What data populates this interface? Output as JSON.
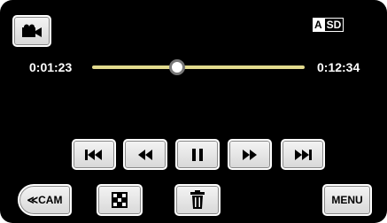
{
  "badge": {
    "a": "A",
    "sd": "SD"
  },
  "playback": {
    "current_time": "0:01:23",
    "total_time": "0:12:34",
    "progress": 0.4
  },
  "bottom_bar": {
    "cam_label": "≪CAM",
    "menu_label": "MENU"
  },
  "icons": {
    "mode": "video-camera-icon",
    "skip_back": "skip-to-start-icon",
    "rewind": "rewind-icon",
    "pause": "pause-icon",
    "forward": "fast-forward-icon",
    "skip_next": "skip-to-end-icon",
    "index": "index-grid-icon",
    "delete": "trash-icon"
  },
  "colors": {
    "background": "#000000",
    "seek_track": "#e2da8e"
  }
}
